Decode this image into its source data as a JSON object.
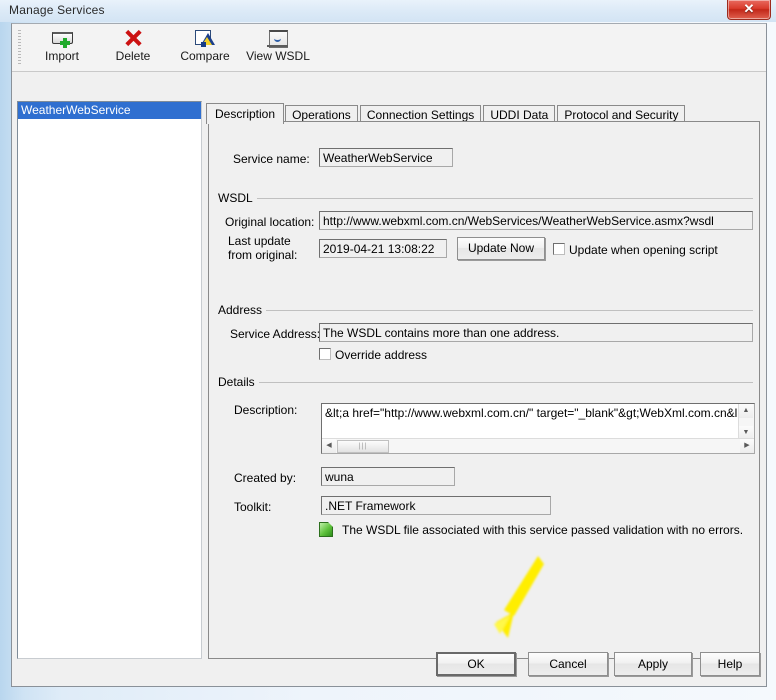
{
  "window": {
    "title": "Manage Services",
    "close_label": "✕"
  },
  "toolbar": {
    "buttons": [
      {
        "label": "Import",
        "icon": "import-icon"
      },
      {
        "label": "Delete",
        "icon": "delete-icon"
      },
      {
        "label": "Compare",
        "icon": "compare-icon"
      },
      {
        "label": "View WSDL",
        "icon": "view-wsdl-icon"
      }
    ]
  },
  "services_list": {
    "items": [
      {
        "label": "WeatherWebService",
        "selected": true
      }
    ]
  },
  "tabs": [
    {
      "label": "Description",
      "active": true
    },
    {
      "label": "Operations",
      "active": false
    },
    {
      "label": "Connection Settings",
      "active": false
    },
    {
      "label": "UDDI Data",
      "active": false
    },
    {
      "label": "Protocol and Security",
      "active": false
    }
  ],
  "description_tab": {
    "service_name": {
      "label": "Service name:",
      "value": "WeatherWebService"
    },
    "wsdl": {
      "group_label": "WSDL",
      "original_location_label": "Original location:",
      "original_location_value": "http://www.webxml.com.cn/WebServices/WeatherWebService.asmx?wsdl",
      "last_update_label_line1": "Last update",
      "last_update_label_line2": "from original:",
      "last_update_value": "2019-04-21 13:08:22",
      "update_now_label": "Update Now",
      "update_on_open_label": "Update when opening script",
      "update_on_open_checked": false
    },
    "address": {
      "group_label": "Address",
      "service_address_label": "Service Address:",
      "service_address_value": "The WSDL contains more than one address.",
      "override_label": "Override address",
      "override_checked": false
    },
    "details": {
      "group_label": "Details",
      "description_label": "Description:",
      "description_value": "&lt;a href=\"http://www.webxml.com.cn/\" target=\"_blank\"&gt;WebXml.com.cn&lt;/a&gt;",
      "created_by_label": "Created by:",
      "created_by_value": "wuna",
      "toolkit_label": "Toolkit:",
      "toolkit_value": ".NET Framework",
      "validation_message": "The WSDL file associated with this service passed validation with no errors.",
      "validation_icon": "green-document-icon"
    }
  },
  "footer": {
    "buttons": [
      {
        "label": "OK",
        "default": true
      },
      {
        "label": "Cancel",
        "default": false
      },
      {
        "label": "Apply",
        "default": false
      },
      {
        "label": "Help",
        "default": false
      }
    ]
  },
  "annotation": {
    "arrow_color": "#ffee00",
    "points_to": "OK"
  },
  "colors": {
    "selection": "#2f6fd0",
    "dialog_bg": "#f0f0f0",
    "close_button": "#d93a2b",
    "annotation_yellow": "#ffee00"
  }
}
